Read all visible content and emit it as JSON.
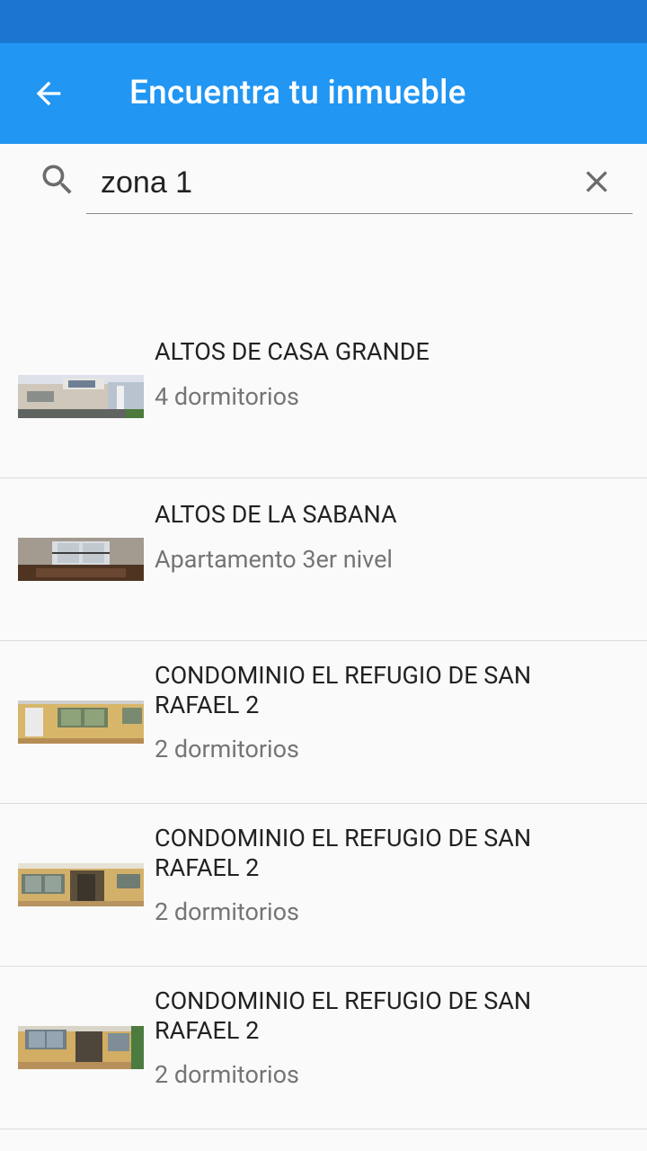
{
  "app_bar": {
    "title": "Encuentra tu inmueble"
  },
  "search": {
    "value": "zona 1"
  },
  "listings": [
    {
      "title": "ALTOS DE CASA GRANDE",
      "subtitle": "4 dormitorios"
    },
    {
      "title": "ALTOS DE LA SABANA",
      "subtitle": "Apartamento 3er nivel"
    },
    {
      "title": "CONDOMINIO EL REFUGIO DE SAN RAFAEL 2",
      "subtitle": "2 dormitorios"
    },
    {
      "title": "CONDOMINIO EL REFUGIO DE SAN RAFAEL 2",
      "subtitle": "2 dormitorios"
    },
    {
      "title": "CONDOMINIO EL REFUGIO DE SAN RAFAEL 2",
      "subtitle": "2 dormitorios"
    }
  ],
  "colors": {
    "status_bar": "#1b76d2",
    "app_bar": "#2196f3",
    "background": "#fafafa"
  }
}
